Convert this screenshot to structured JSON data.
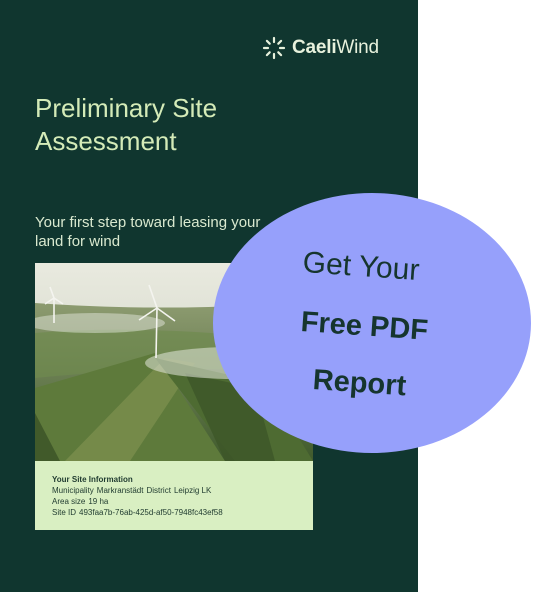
{
  "brand": {
    "name_bold": "Caeli",
    "name_regular": "Wind",
    "icon": "sun-burst-logo-icon"
  },
  "report": {
    "title_line1": "Preliminary Site",
    "title_line2": "Assessment",
    "subtitle": "Your first step toward leasing your land for wind",
    "image": "aerial-wind-farm-photo"
  },
  "site_info": {
    "heading": "Your Site Information",
    "municipality_label": "Municipality",
    "municipality_value": "Markranstädt",
    "district_label": "District",
    "district_value": "Leipzig LK",
    "area_label": "Area size",
    "area_value": "19 ha",
    "site_id_label": "Site ID",
    "site_id_value": "493faa7b-76ab-425d-af50-7948fc43ef58"
  },
  "cta": {
    "line1": "Get Your",
    "line2": "Free PDF",
    "line3": "Report",
    "color": "#96a0fb"
  },
  "colors": {
    "background": "#10362f",
    "title": "#d4ebb8",
    "info_panel": "#d9efc2"
  }
}
